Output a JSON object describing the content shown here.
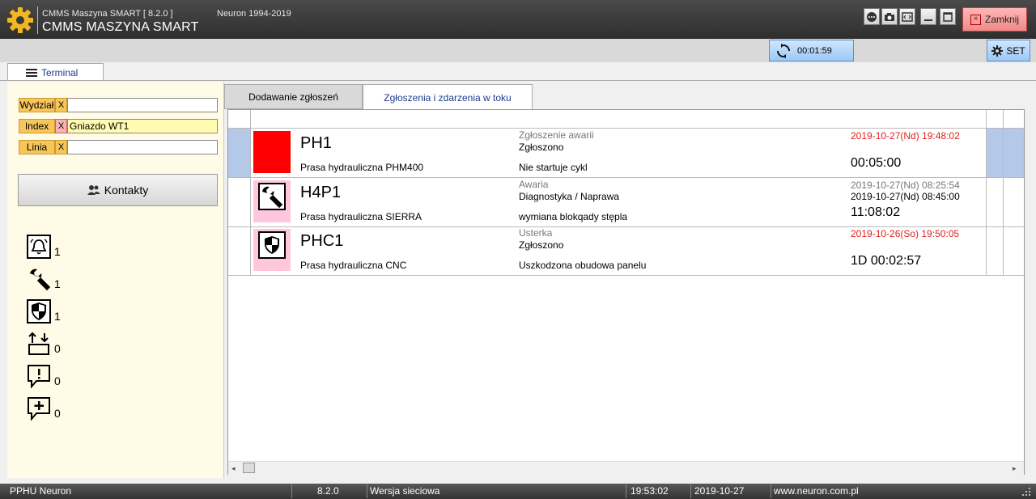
{
  "window": {
    "title_small": "CMMS Maszyna SMART  [  8.2.0  ]",
    "title_large": "CMMS MASZYNA SMART",
    "copyright": "Neuron 1994-2019",
    "close_label": "Zamknij"
  },
  "toolbar": {
    "timer": "00:01:59",
    "set_label": "SET"
  },
  "left_tab": {
    "label": "Terminal"
  },
  "filters": [
    {
      "label": "Wydział",
      "clear": "X",
      "value": ""
    },
    {
      "label": "Index",
      "clear": "X",
      "value": "Gniazdo WT1"
    },
    {
      "label": "Linia",
      "clear": "X",
      "value": ""
    }
  ],
  "contacts_button": "Kontakty",
  "counters": [
    {
      "icon": "bell-icon",
      "count": "1"
    },
    {
      "icon": "wrench-icon",
      "count": "1"
    },
    {
      "icon": "shield-icon",
      "count": "1"
    },
    {
      "icon": "transfer-icon",
      "count": "0"
    },
    {
      "icon": "alert-comment-icon",
      "count": "0"
    },
    {
      "icon": "add-comment-icon",
      "count": "0"
    }
  ],
  "tabs": [
    {
      "label": "Dodawanie zgłoszeń"
    },
    {
      "label": "Zgłoszenia i zdarzenia w toku"
    }
  ],
  "rows": [
    {
      "icon": "red-square",
      "code": "PH1",
      "machine": "Prasa hydrauliczna PHM400",
      "type": "Zgłoszenie awarii",
      "status": "Zgłoszono",
      "description": "Nie startuje cykl",
      "date1": "2019-10-27(Nd) 19:48:02",
      "date2": "",
      "duration": "00:05:00"
    },
    {
      "icon": "wrench-icon",
      "code": "H4P1",
      "machine": "Prasa hydrauliczna SIERRA",
      "type": "Awaria",
      "status": "Diagnostyka / Naprawa",
      "description": "wymiana blokqady stępla",
      "date1": "2019-10-27(Nd) 08:25:54",
      "date2": "2019-10-27(Nd) 08:45:00",
      "duration": "11:08:02"
    },
    {
      "icon": "shield-icon",
      "code": "PHC1",
      "machine": "Prasa hydrauliczna CNC",
      "type": "Usterka",
      "status": "Zgłoszono",
      "description": "Uszkodzona obudowa panelu",
      "date1": "2019-10-26(So) 19:50:05",
      "date2": "",
      "duration": "1D 00:02:57"
    }
  ],
  "colors": {
    "accent_red": "#ff0000",
    "date_red": "#e0201e",
    "date_gray": "#777777",
    "pink": "#ffc6dc",
    "selection": "#b4c9e8",
    "filter_orange": "#f7c65a",
    "filter_yellow": "#fffbb0"
  },
  "statusbar": {
    "company": "PPHU Neuron",
    "version": "8.2.0",
    "mode": "Wersja sieciowa",
    "time": "19:53:02",
    "date": "2019-10-27",
    "website": "www.neuron.com.pl"
  }
}
